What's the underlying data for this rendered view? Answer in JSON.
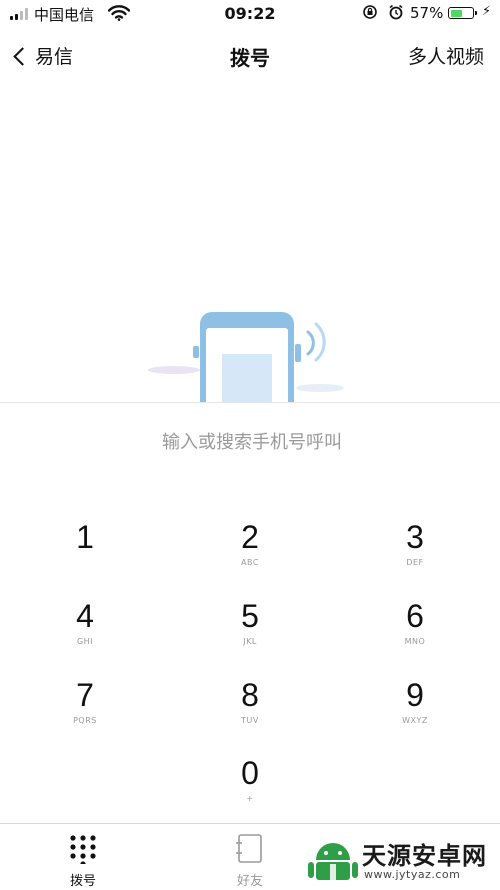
{
  "status_bar": {
    "carrier": "中国电信",
    "time": "09:22",
    "battery_percent": "57%",
    "battery_level": 0.57,
    "battery_color": "#4cd964",
    "icons": [
      "signal-bars-icon",
      "wifi-icon",
      "rotation-lock-icon",
      "alarm-icon",
      "battery-icon",
      "charging-bolt-icon"
    ]
  },
  "nav": {
    "back_label": "易信",
    "title": "拨号",
    "right_action": "多人视频"
  },
  "dialer": {
    "placeholder": "输入或搜索手机号呼叫",
    "value": ""
  },
  "keypad": {
    "keys": [
      {
        "digit": "1",
        "letters": ""
      },
      {
        "digit": "2",
        "letters": "ABC"
      },
      {
        "digit": "3",
        "letters": "DEF"
      },
      {
        "digit": "4",
        "letters": "GHI"
      },
      {
        "digit": "5",
        "letters": "JKL"
      },
      {
        "digit": "6",
        "letters": "MNO"
      },
      {
        "digit": "7",
        "letters": "PQRS"
      },
      {
        "digit": "8",
        "letters": "TUV"
      },
      {
        "digit": "9",
        "letters": "WXYZ"
      },
      {
        "digit": "0",
        "letters": "+"
      }
    ]
  },
  "tabs": [
    {
      "label": "拨号",
      "icon": "dialpad-icon",
      "active": true
    },
    {
      "label": "好友",
      "icon": "contacts-book-icon",
      "active": false
    }
  ],
  "colors": {
    "illustration_blue": "#8ec0e6",
    "inactive_tab": "#9a9a9a",
    "watermark_green": "#2e9e48"
  },
  "watermark": {
    "text": "天源安卓网",
    "url": "www.jytyaz.com"
  }
}
